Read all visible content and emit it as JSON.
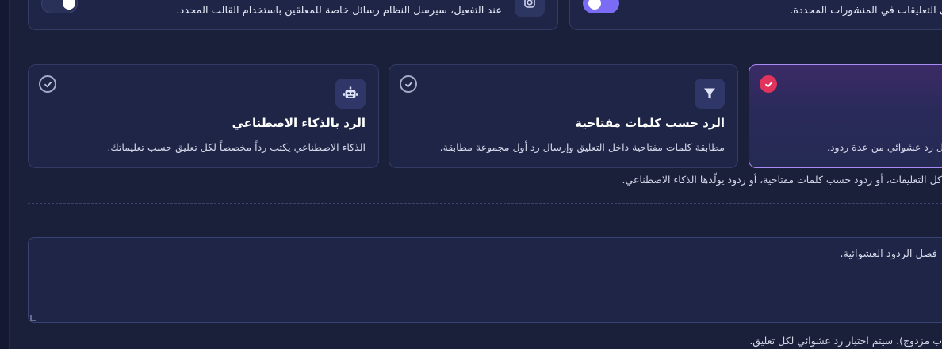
{
  "top_cards": {
    "left": {
      "text": "عند التفعيل، سيرسل النظام رسائل خاصة للمعلقين باستخدام القالب المحدد.",
      "icon": "instagram-icon",
      "toggle": "off"
    },
    "right": {
      "text": "على التعليقات في المنشورات المحددة.",
      "toggle": "on"
    }
  },
  "modes": {
    "ai": {
      "title": "الرد بالذكاء الاصطناعي",
      "desc": "الذكاء الاصطناعي يكتب رداً مخصصاً لكل تعليق حسب تعليماتك.",
      "icon": "robot-icon",
      "selected": false
    },
    "keyword": {
      "title": "الرد حسب كلمات مفتاحية",
      "desc": "مطابقة كلمات مفتاحية داخل التعليق وإرسال رد أول مجموعة مطابقة.",
      "icon": "filter-icon",
      "selected": false
    },
    "random": {
      "desc": "سال رد عشوائي من عدة ردود.",
      "selected": true
    }
  },
  "helper_text": "كل التعليقات، أو ردود حسب كلمات مفتاحية، أو ردود يولّدها الذكاء الاصطناعي.",
  "replies_textarea": {
    "placeholder": "فصل الردود العشوائية."
  },
  "footer_note": "ب مزدوج). سيتم اختيار رد عشوائي لكل تعليق.",
  "colors": {
    "background": "#1a1f3a",
    "card": "#1f2547",
    "accent": "#7b6cf6",
    "selected_check": "#e0345c"
  }
}
